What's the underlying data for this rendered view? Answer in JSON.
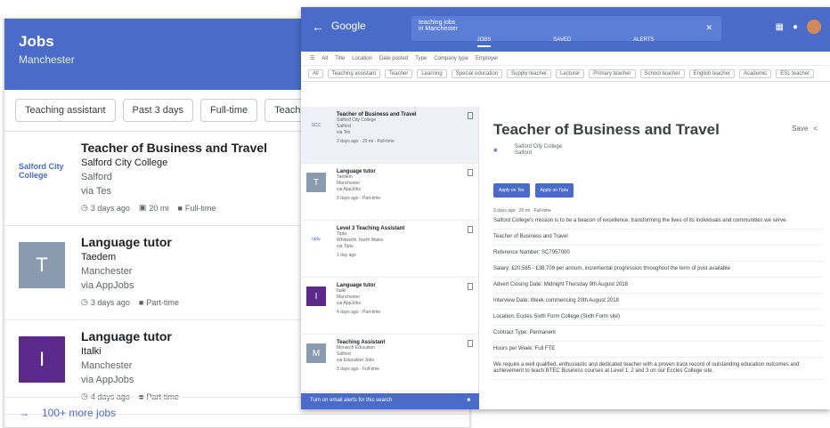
{
  "mobile": {
    "header_title": "Jobs",
    "header_location": "Manchester",
    "chips": [
      "Teaching assistant",
      "Past 3 days",
      "Full-time",
      "Teacher"
    ],
    "jobs": [
      {
        "title": "Teacher of Business and Travel",
        "employer": "Salford City College",
        "location": "Salford",
        "via": "via Tes",
        "meta": [
          "3 days ago",
          "20 mi",
          "Full-time"
        ],
        "thumb": "logo",
        "thumb_label": "Salford City College",
        "thumb_color": "#ffffff"
      },
      {
        "title": "Language tutor",
        "employer": "Taedem",
        "location": "Manchester",
        "via": "via AppJobs",
        "meta": [
          "3 days ago",
          "Part-time"
        ],
        "thumb": "T",
        "thumb_color": "#8a9bb0"
      },
      {
        "title": "Language tutor",
        "employer": "Italki",
        "location": "Manchester",
        "via": "via AppJobs",
        "meta": [
          "4 days ago",
          "Part-time"
        ],
        "thumb": "I",
        "thumb_color": "#5b2a8c"
      }
    ],
    "more_label": "100+ more jobs"
  },
  "desktop": {
    "logo": "Google",
    "search_query": "teaching jobs",
    "search_sub": "in Manchester",
    "tabs": [
      "JOBS",
      "SAVED",
      "ALERTS"
    ],
    "filter_row1": [
      "All",
      "Title",
      "Location",
      "Date posted",
      "Type",
      "Company type",
      "Employer"
    ],
    "filter_row2": [
      "All",
      "Teaching assistant",
      "Teacher",
      "Learning",
      "Special education",
      "Supply teacher",
      "Lecturer",
      "Primary teacher",
      "School teacher",
      "English teacher",
      "Academic",
      "ESL teacher"
    ],
    "list": [
      {
        "title": "Teacher of Business and Travel",
        "lines": [
          "Salford City College",
          "Salford",
          "via Tes"
        ],
        "meta": "3 days ago · 20 mi · Full-time",
        "thumb": "logo",
        "thumb_label": "SCC",
        "thumb_color": "#ffffff"
      },
      {
        "title": "Language tutor",
        "lines": [
          "Taedem",
          "Manchester",
          "via AppJobs"
        ],
        "meta": "3 days ago · Part-time",
        "thumb": "T",
        "thumb_color": "#8a9bb0"
      },
      {
        "title": "Level 3 Teaching Assistant",
        "lines": [
          "Tiptu",
          "Whitworth, North Wales",
          "via Tiptu"
        ],
        "meta": "1 day ago",
        "thumb": "logo",
        "thumb_label": "tiptu",
        "thumb_color": "#ffffff"
      },
      {
        "title": "Language tutor",
        "lines": [
          "Italki",
          "Manchester",
          "via AppJobs"
        ],
        "meta": "4 days ago · Part-time",
        "thumb": "I",
        "thumb_color": "#5b2a8c"
      },
      {
        "title": "Teaching Assistant",
        "lines": [
          "Monarch Education",
          "Salford",
          "via Education Jobs"
        ],
        "meta": "3 days ago · Full-time",
        "thumb": "M",
        "thumb_color": "#8a9bb0"
      }
    ],
    "footer_text": "Turn on email alerts for this search",
    "detail": {
      "title": "Teacher of Business and Travel",
      "employer": "Salford City College",
      "location": "Salford",
      "actions": [
        "Save",
        "Share"
      ],
      "apply_buttons": [
        "Apply on Tes",
        "Apply on Tiptu"
      ],
      "meta": "3 days ago · 20 mi · Full-time",
      "lines": [
        "Salford College's mission is to be a beacon of excellence, transforming the lives of its individuals and communities we serve.",
        "Teacher of Business and Travel",
        "Reference Number: SC7957000",
        "Salary: £20,585 - £38,709 per annum, incremental progression throughout the term of post available",
        "Advert Closing Date: Midnight Thursday 9th August 2018",
        "Interview Date: Week commencing 20th August 2018",
        "Location: Eccles Sixth Form College (Sixth Form site)",
        "Contract Type: Permanent",
        "Hours per Week: Full FTE",
        "We require a well qualified, enthusiastic and dedicated teacher with a proven track record of outstanding education outcomes and achievement to teach BTEC Business courses at Level 1, 2 and 3 on our Eccles College site."
      ]
    }
  }
}
